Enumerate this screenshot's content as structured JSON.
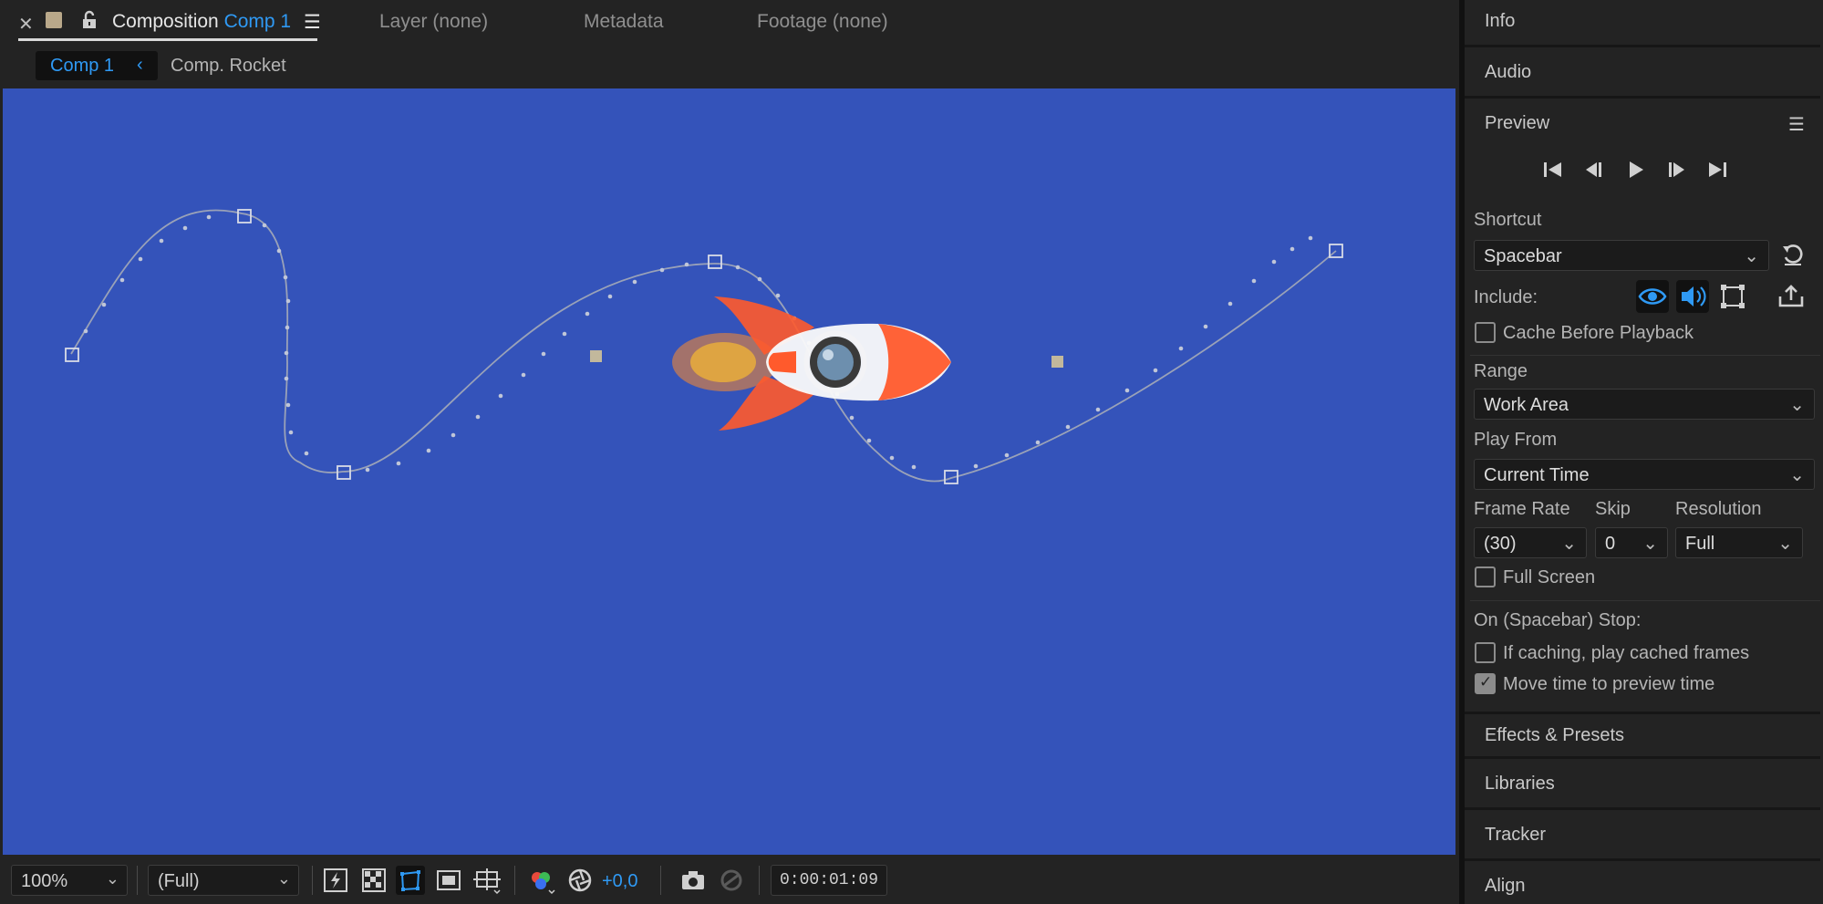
{
  "tabs": {
    "composition_label": "Composition",
    "composition_name": "Comp 1",
    "layer": "Layer (none)",
    "metadata": "Metadata",
    "footage": "Footage (none)"
  },
  "breadcrumb": {
    "active": "Comp 1",
    "next": "Comp. Rocket"
  },
  "colors": {
    "viewer_bg": "#3453ba",
    "accent": "#2f9af5",
    "label_swatch": "#b9a88a"
  },
  "bottombar": {
    "zoom": "100%",
    "resolution": "(Full)",
    "exposure": "+0,0",
    "timecode": "0:00:01:09"
  },
  "right_panel": {
    "panels": {
      "info": "Info",
      "audio": "Audio",
      "preview": "Preview",
      "effects": "Effects & Presets",
      "libraries": "Libraries",
      "tracker": "Tracker",
      "align": "Align"
    },
    "shortcut_label": "Shortcut",
    "shortcut_value": "Spacebar",
    "include_label": "Include:",
    "cache_before_playback": "Cache Before Playback",
    "range_label": "Range",
    "range_value": "Work Area",
    "play_from_label": "Play From",
    "play_from_value": "Current Time",
    "frame_rate_label": "Frame Rate",
    "frame_rate_value": "(30)",
    "skip_label": "Skip",
    "skip_value": "0",
    "resolution_label": "Resolution",
    "resolution_value": "Full",
    "full_screen": "Full Screen",
    "on_stop_label": "On (Spacebar) Stop:",
    "if_caching": "If caching, play cached frames",
    "move_time": "Move time to preview time",
    "checkbox_state": {
      "cache_before_playback": false,
      "full_screen": false,
      "if_caching": false,
      "move_time": true
    }
  },
  "icons": {
    "close": "close-icon",
    "lock": "unlock-icon",
    "menu": "hamburger-menu-icon",
    "chevron": "chevron-left-icon",
    "first_frame": "first-frame-icon",
    "prev_frame": "previous-frame-icon",
    "play": "play-icon",
    "next_frame": "next-frame-icon",
    "last_frame": "last-frame-icon",
    "reset": "reset-icon",
    "eye": "eye-icon",
    "speaker": "speaker-icon",
    "overlay": "overlay-icon",
    "export": "export-icon",
    "camera": "camera-icon"
  }
}
